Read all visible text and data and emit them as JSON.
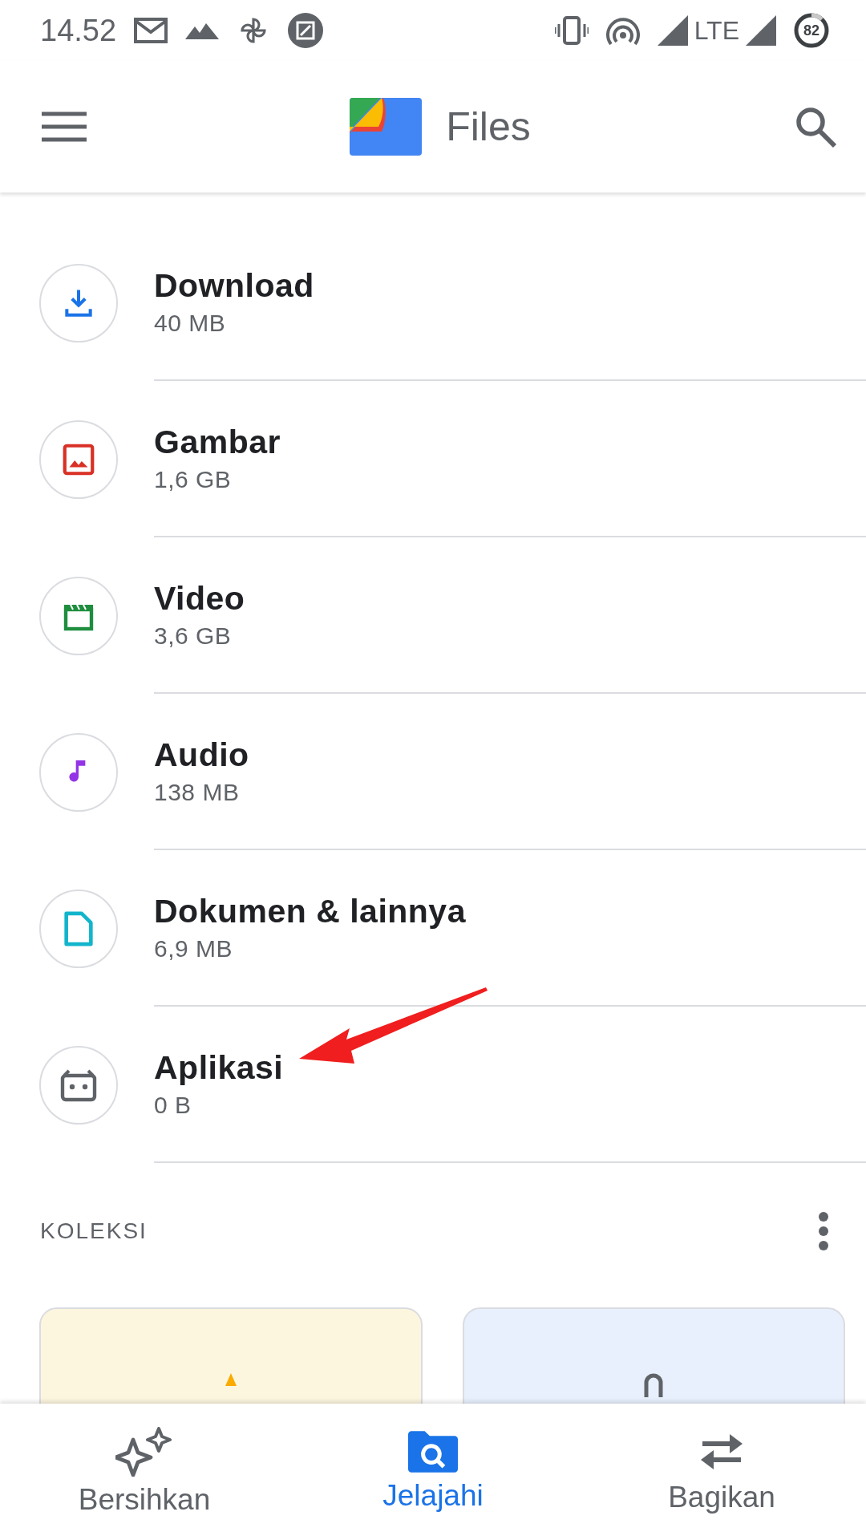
{
  "status_bar": {
    "time": "14.52",
    "network": "LTE",
    "battery": "82"
  },
  "app_bar": {
    "title": "Files"
  },
  "categories": [
    {
      "name": "Download",
      "size": "40 MB",
      "kind": "download",
      "color": "#1a73e8"
    },
    {
      "name": "Gambar",
      "size": "1,6 GB",
      "kind": "image",
      "color": "#d93025"
    },
    {
      "name": "Video",
      "size": "3,6 GB",
      "kind": "video",
      "color": "#1e8e3e"
    },
    {
      "name": "Audio",
      "size": "138 MB",
      "kind": "audio",
      "color": "#9334e6"
    },
    {
      "name": "Dokumen & lainnya",
      "size": "6,9 MB",
      "kind": "document",
      "color": "#12b5cb"
    },
    {
      "name": "Aplikasi",
      "size": "0 B",
      "kind": "app",
      "color": "#5f6368"
    }
  ],
  "section": {
    "title": "KOLEKSI"
  },
  "collections": [
    {
      "kind": "star"
    },
    {
      "kind": "lock"
    }
  ],
  "bottom_nav": [
    {
      "label": "Bersihkan",
      "kind": "clean",
      "selected": false
    },
    {
      "label": "Jelajahi",
      "kind": "browse",
      "selected": true
    },
    {
      "label": "Bagikan",
      "kind": "share",
      "selected": false
    }
  ]
}
